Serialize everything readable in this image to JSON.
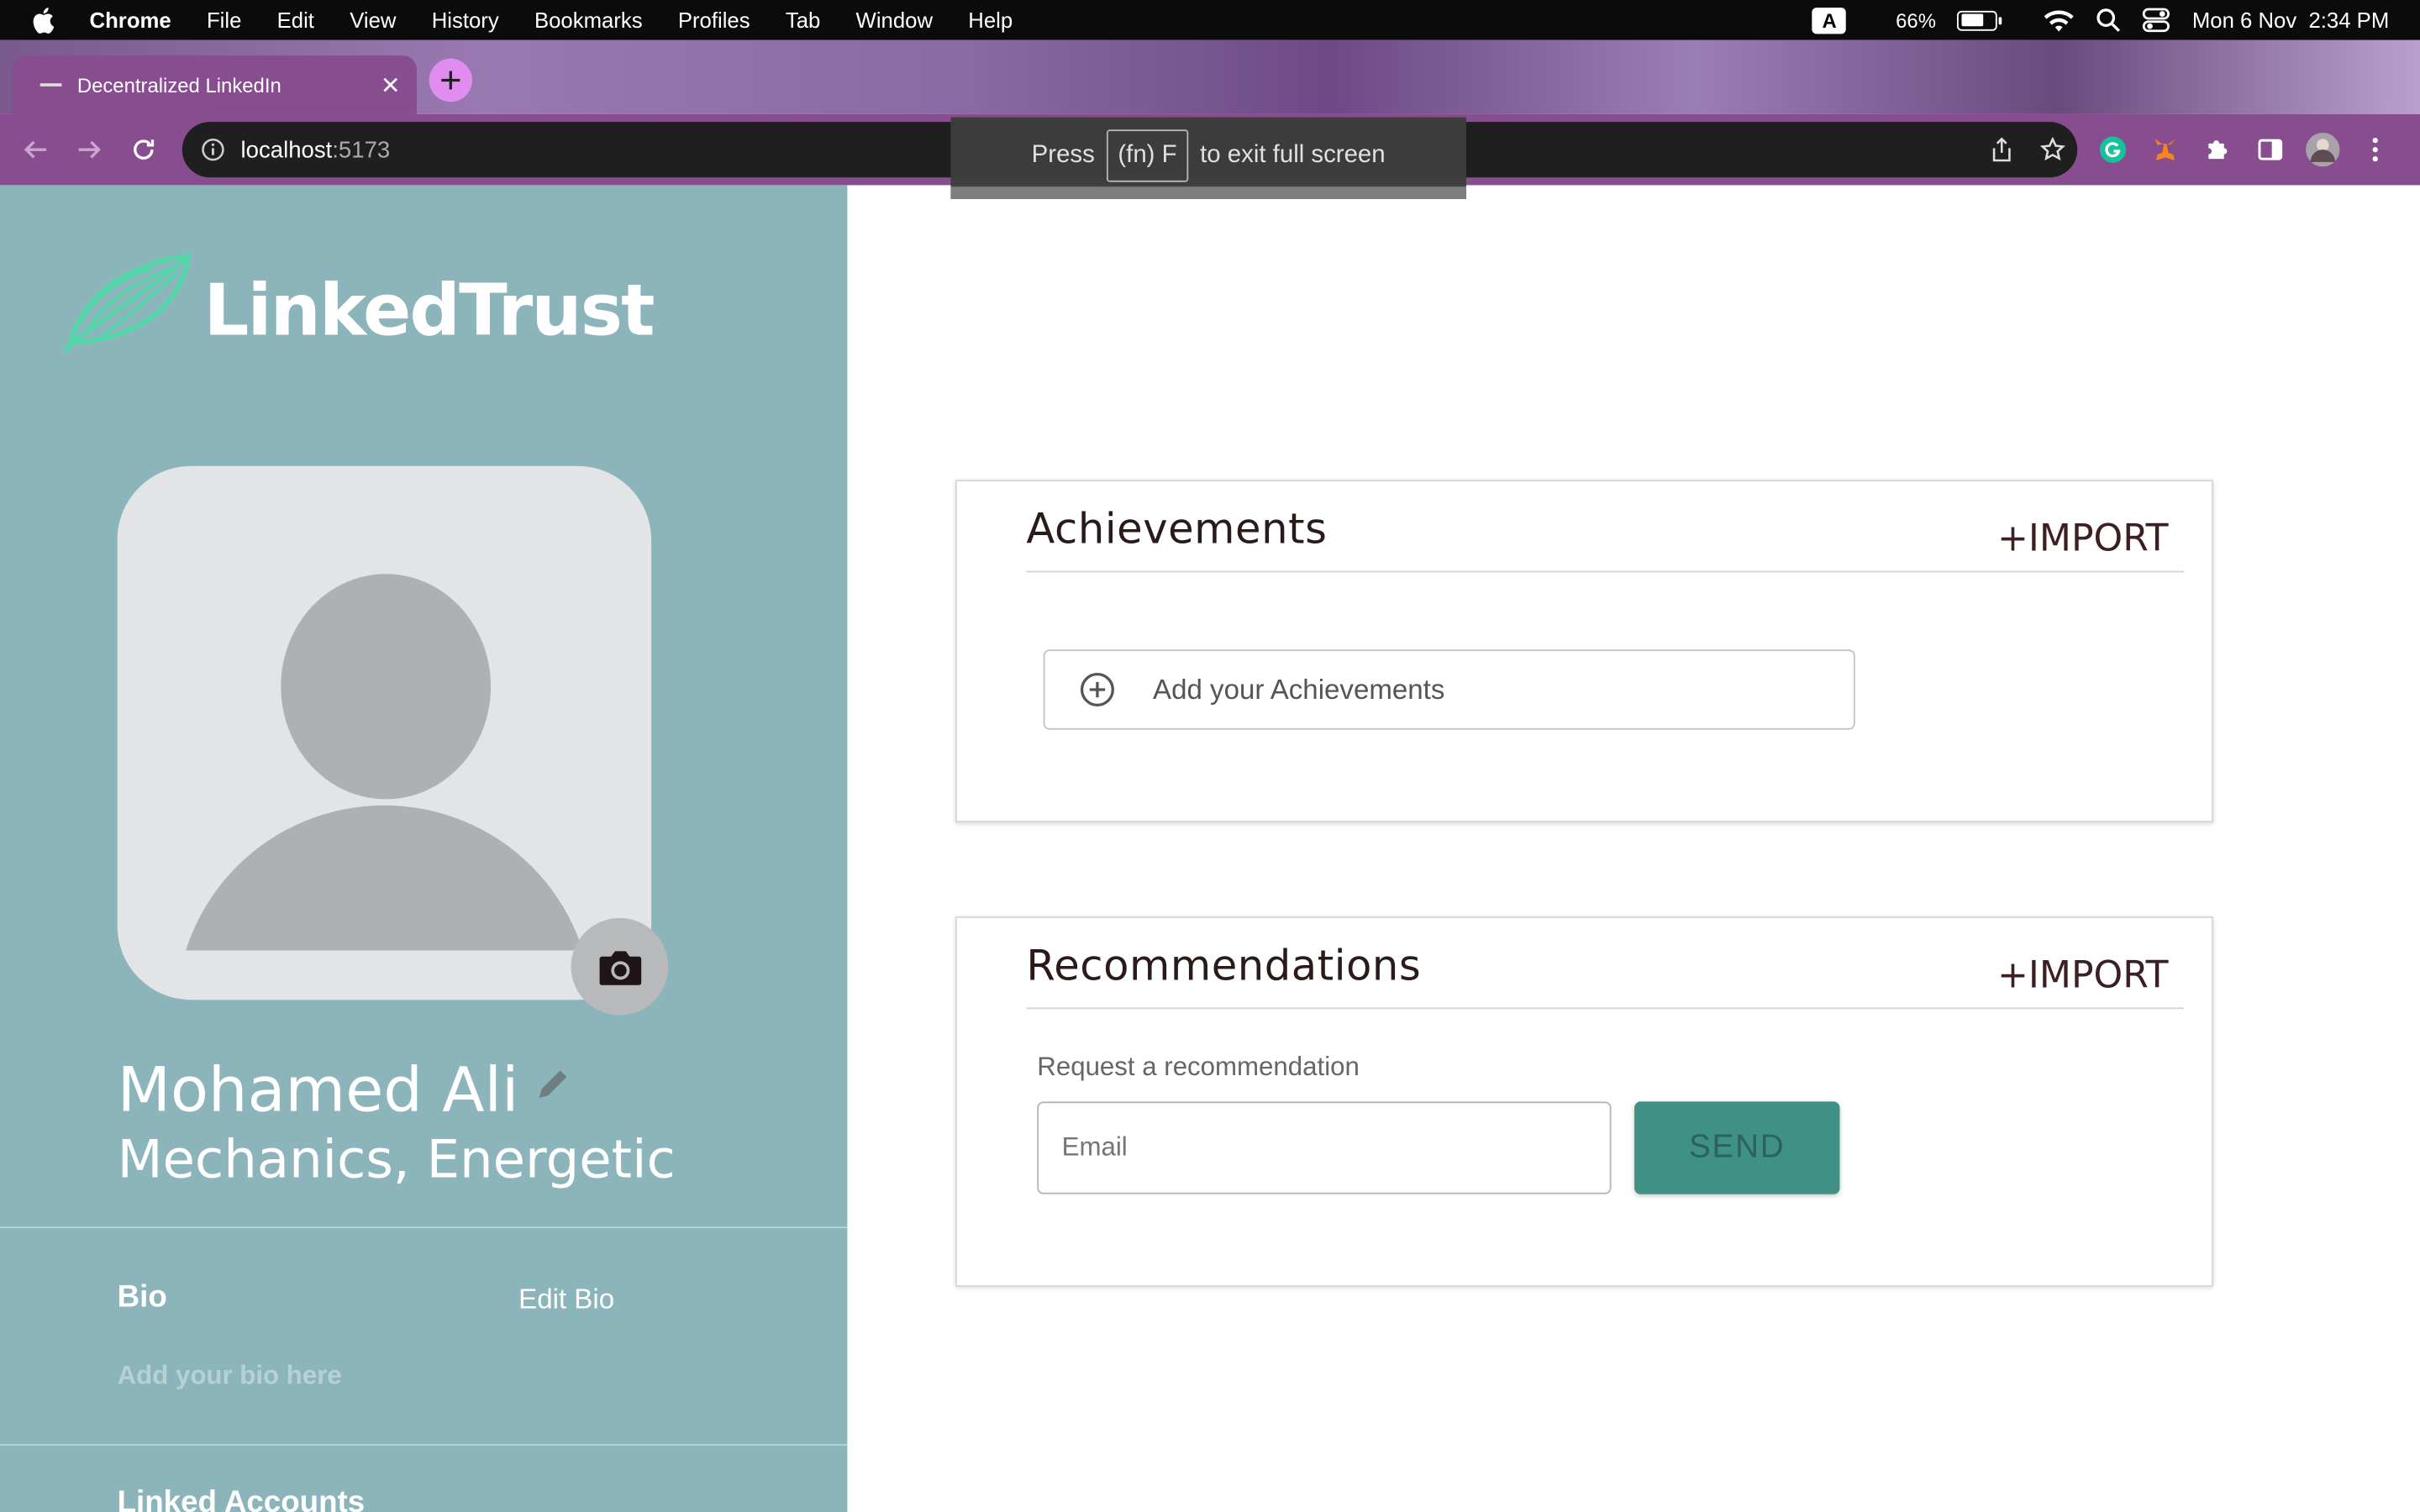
{
  "menubar": {
    "app": "Chrome",
    "items": [
      "File",
      "Edit",
      "View",
      "History",
      "Bookmarks",
      "Profiles",
      "Tab",
      "Window",
      "Help"
    ],
    "input_indicator": "A",
    "battery": "66%",
    "battery_level": 0.66,
    "datetime": "Mon 6 Nov  2:34 PM"
  },
  "browser": {
    "tab_title": "Decentralized LinkedIn",
    "url_host": "localhost",
    "url_port": ":5173",
    "fullscreen_toast": {
      "press": "Press",
      "key": "(fn) F",
      "rest": "to exit full screen"
    }
  },
  "sidebar": {
    "brand": "LinkedTrust",
    "name": "Mohamed Ali",
    "headline": "Mechanics, Energetic",
    "bio_label": "Bio",
    "edit_bio": "Edit Bio",
    "bio_placeholder": "Add your bio here",
    "linked_accounts": "Linked Accounts"
  },
  "achievements": {
    "title": "Achievements",
    "import": "+IMPORT",
    "add_label": "Add your Achievements"
  },
  "recommendations": {
    "title": "Recommendations",
    "import": "+IMPORT",
    "request_label": "Request a recommendation",
    "email_placeholder": "Email",
    "send": "SEND"
  },
  "colors": {
    "sidebar_bg": "#8cb5bb",
    "send_button": "#3f9185",
    "chrome_toolbar": "#874d8e"
  }
}
